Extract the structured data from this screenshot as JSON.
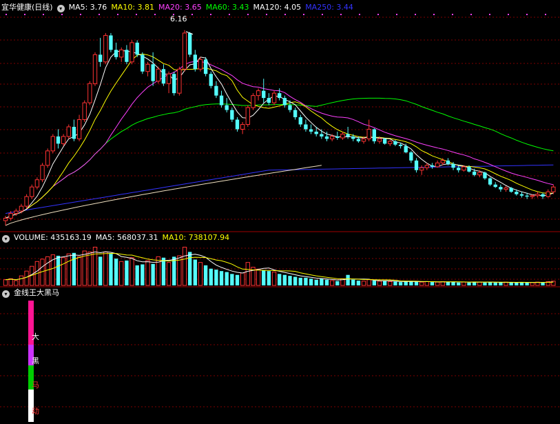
{
  "main_header": {
    "title": "宜华健康(日线)",
    "toggle_glyph": "▾",
    "ma": [
      {
        "label": "MA5: 3.76",
        "color": "#ffffff"
      },
      {
        "label": "MA10: 3.81",
        "color": "#ffff00"
      },
      {
        "label": "MA20: 3.65",
        "color": "#ff40ff"
      },
      {
        "label": "MA60: 3.43",
        "color": "#00ff00"
      },
      {
        "label": "MA120: 4.05",
        "color": "#ffffff"
      },
      {
        "label": "MA250: 3.44",
        "color": "#3333ff"
      }
    ]
  },
  "peak_label": "6.16",
  "volume_header": {
    "title": "VOLUME: 435163.19",
    "ma5": "MA5: 568037.31",
    "ma10": "MA10: 738107.94",
    "ma10_color": "#ffff00"
  },
  "indicator_header": {
    "title": "金线王大黑马"
  },
  "indicator_labels": [
    "大",
    "黑",
    "马",
    "动"
  ],
  "colors": {
    "up": "#ff3333",
    "down": "#54fcfc",
    "grid": "#800000",
    "border": "#a00000",
    "ma5": "#ffffff",
    "ma10": "#ffff00",
    "ma20": "#ff40ff",
    "ma60": "#00ff00",
    "ma120": "#f0e0c0",
    "ma250": "#3333ff"
  },
  "chart_data": {
    "type": "candlestick",
    "price_peak": 6.16,
    "candles": [
      [
        2.2,
        2.3,
        2.1,
        2.25
      ],
      [
        2.25,
        2.4,
        2.2,
        2.35
      ],
      [
        2.35,
        2.45,
        2.3,
        2.4
      ],
      [
        2.4,
        2.55,
        2.35,
        2.5
      ],
      [
        2.5,
        2.75,
        2.45,
        2.7
      ],
      [
        2.7,
        2.95,
        2.65,
        2.9
      ],
      [
        2.9,
        3.1,
        2.85,
        3.05
      ],
      [
        3.05,
        3.4,
        3.0,
        3.35
      ],
      [
        3.35,
        3.7,
        3.3,
        3.65
      ],
      [
        3.65,
        4.0,
        3.6,
        3.95
      ],
      [
        3.95,
        4.1,
        3.7,
        3.8
      ],
      [
        3.8,
        4.0,
        3.75,
        3.95
      ],
      [
        3.95,
        4.2,
        3.9,
        4.15
      ],
      [
        4.15,
        4.3,
        3.85,
        3.9
      ],
      [
        3.9,
        4.4,
        3.85,
        4.3
      ],
      [
        4.3,
        4.7,
        4.25,
        4.65
      ],
      [
        4.65,
        5.1,
        4.6,
        5.05
      ],
      [
        5.05,
        5.7,
        5.0,
        5.65
      ],
      [
        5.65,
        6.0,
        5.4,
        5.5
      ],
      [
        5.5,
        6.1,
        5.45,
        6.05
      ],
      [
        6.05,
        6.1,
        5.7,
        5.75
      ],
      [
        5.75,
        5.9,
        5.55,
        5.6
      ],
      [
        5.6,
        5.8,
        5.5,
        5.75
      ],
      [
        5.75,
        5.85,
        5.45,
        5.5
      ],
      [
        5.5,
        5.95,
        5.45,
        5.9
      ],
      [
        5.9,
        5.95,
        5.6,
        5.65
      ],
      [
        5.65,
        5.7,
        5.25,
        5.3
      ],
      [
        5.3,
        5.5,
        5.2,
        5.45
      ],
      [
        5.45,
        5.7,
        5.0,
        5.1
      ],
      [
        5.1,
        5.4,
        5.05,
        5.35
      ],
      [
        5.35,
        5.45,
        5.0,
        5.05
      ],
      [
        5.05,
        5.3,
        4.85,
        5.25
      ],
      [
        5.25,
        5.3,
        4.8,
        4.85
      ],
      [
        4.85,
        5.4,
        4.8,
        5.35
      ],
      [
        5.35,
        6.16,
        5.3,
        6.1
      ],
      [
        6.1,
        6.12,
        5.6,
        5.65
      ],
      [
        5.65,
        5.75,
        5.3,
        5.35
      ],
      [
        5.35,
        5.6,
        5.3,
        5.55
      ],
      [
        5.55,
        5.6,
        5.2,
        5.25
      ],
      [
        5.25,
        5.3,
        4.95,
        5.0
      ],
      [
        5.0,
        5.1,
        4.75,
        4.8
      ],
      [
        4.8,
        4.9,
        4.55,
        4.6
      ],
      [
        4.6,
        4.75,
        4.45,
        4.5
      ],
      [
        4.5,
        4.55,
        4.25,
        4.3
      ],
      [
        4.3,
        4.35,
        4.05,
        4.1
      ],
      [
        4.1,
        4.25,
        4.0,
        4.2
      ],
      [
        4.2,
        4.6,
        4.15,
        4.55
      ],
      [
        4.55,
        4.85,
        4.5,
        4.8
      ],
      [
        4.8,
        4.95,
        4.7,
        4.9
      ],
      [
        4.9,
        5.15,
        4.65,
        4.75
      ],
      [
        4.75,
        4.85,
        4.6,
        4.65
      ],
      [
        4.65,
        4.9,
        4.6,
        4.85
      ],
      [
        4.85,
        4.95,
        4.7,
        4.75
      ],
      [
        4.75,
        4.8,
        4.55,
        4.6
      ],
      [
        4.6,
        4.7,
        4.45,
        4.5
      ],
      [
        4.5,
        4.55,
        4.3,
        4.35
      ],
      [
        4.35,
        4.4,
        4.15,
        4.2
      ],
      [
        4.2,
        4.3,
        4.05,
        4.1
      ],
      [
        4.1,
        4.2,
        4.0,
        4.05
      ],
      [
        4.05,
        4.15,
        3.95,
        4.0
      ],
      [
        4.0,
        4.1,
        3.9,
        3.95
      ],
      [
        3.95,
        4.05,
        3.85,
        3.9
      ],
      [
        3.9,
        4.0,
        3.85,
        3.95
      ],
      [
        3.95,
        4.05,
        3.88,
        3.92
      ],
      [
        3.92,
        4.05,
        3.88,
        4.0
      ],
      [
        4.0,
        4.15,
        3.9,
        3.95
      ],
      [
        3.95,
        4.0,
        3.85,
        3.9
      ],
      [
        3.9,
        3.95,
        3.82,
        3.85
      ],
      [
        3.85,
        3.95,
        3.8,
        3.9
      ],
      [
        3.9,
        4.3,
        3.85,
        4.1
      ],
      [
        4.1,
        4.12,
        3.8,
        3.85
      ],
      [
        3.85,
        3.95,
        3.8,
        3.9
      ],
      [
        3.9,
        3.92,
        3.78,
        3.8
      ],
      [
        3.8,
        3.88,
        3.75,
        3.85
      ],
      [
        3.85,
        3.88,
        3.75,
        3.78
      ],
      [
        3.78,
        3.82,
        3.7,
        3.75
      ],
      [
        3.75,
        3.8,
        3.6,
        3.62
      ],
      [
        3.62,
        3.65,
        3.4,
        3.45
      ],
      [
        3.45,
        3.5,
        3.2,
        3.25
      ],
      [
        3.25,
        3.35,
        3.15,
        3.3
      ],
      [
        3.3,
        3.4,
        3.25,
        3.35
      ],
      [
        3.35,
        3.4,
        3.28,
        3.32
      ],
      [
        3.32,
        3.45,
        3.3,
        3.4
      ],
      [
        3.4,
        3.5,
        3.35,
        3.45
      ],
      [
        3.45,
        3.5,
        3.35,
        3.38
      ],
      [
        3.38,
        3.42,
        3.25,
        3.3
      ],
      [
        3.3,
        3.35,
        3.2,
        3.25
      ],
      [
        3.25,
        3.35,
        3.22,
        3.32
      ],
      [
        3.32,
        3.35,
        3.2,
        3.22
      ],
      [
        3.22,
        3.28,
        3.12,
        3.15
      ],
      [
        3.15,
        3.25,
        3.1,
        3.2
      ],
      [
        3.2,
        3.22,
        3.05,
        3.08
      ],
      [
        3.08,
        3.1,
        2.92,
        2.95
      ],
      [
        2.95,
        3.0,
        2.88,
        2.9
      ],
      [
        2.9,
        2.95,
        2.8,
        2.85
      ],
      [
        2.85,
        2.92,
        2.8,
        2.88
      ],
      [
        2.88,
        2.9,
        2.78,
        2.8
      ],
      [
        2.8,
        2.85,
        2.72,
        2.75
      ],
      [
        2.75,
        2.8,
        2.68,
        2.72
      ],
      [
        2.72,
        2.78,
        2.65,
        2.7
      ],
      [
        2.7,
        2.75,
        2.65,
        2.72
      ],
      [
        2.72,
        2.8,
        2.68,
        2.75
      ],
      [
        2.75,
        2.78,
        2.65,
        2.7
      ],
      [
        2.7,
        2.85,
        2.68,
        2.8
      ],
      [
        2.8,
        2.95,
        2.75,
        2.9
      ]
    ],
    "volume": [
      12,
      14,
      10,
      20,
      30,
      40,
      50,
      55,
      60,
      64,
      62,
      58,
      66,
      68,
      60,
      72,
      70,
      80,
      60,
      70,
      66,
      56,
      50,
      52,
      58,
      42,
      44,
      52,
      45,
      60,
      58,
      48,
      60,
      62,
      80,
      70,
      54,
      48,
      42,
      35,
      33,
      30,
      28,
      24,
      22,
      26,
      48,
      38,
      34,
      32,
      30,
      28,
      24,
      22,
      20,
      18,
      16,
      16,
      14,
      12,
      14,
      12,
      10,
      9,
      14,
      22,
      12,
      10,
      9,
      12,
      10,
      9,
      9,
      8,
      8,
      7,
      8,
      9,
      8,
      7,
      8,
      7,
      7,
      8,
      7,
      8,
      6,
      7,
      6,
      8,
      7,
      6,
      7,
      6,
      6,
      7,
      6,
      6,
      7,
      6,
      6,
      7,
      6,
      8,
      9
    ]
  }
}
